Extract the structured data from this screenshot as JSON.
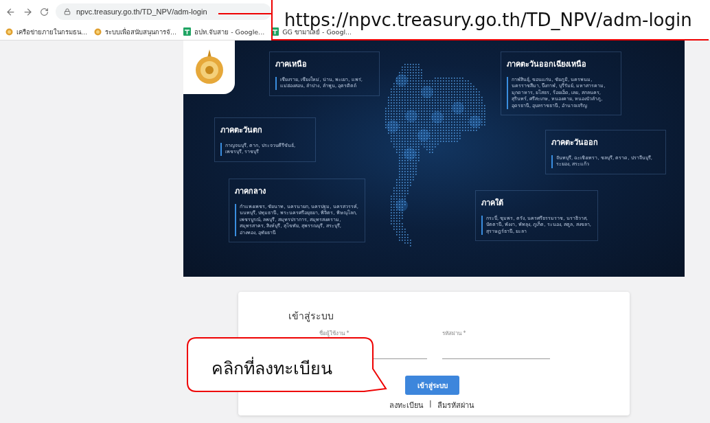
{
  "browser": {
    "url": "npvc.treasury.go.th/TD_NPV/adm-login",
    "bookmarks": [
      {
        "label": "เครือข่ายภายในกรมธน...",
        "kind": "emblem"
      },
      {
        "label": "ระบบเพื่อสนับสนุนการจั...",
        "kind": "emblem"
      },
      {
        "label": "อปท.จับสาย - Google...",
        "kind": "sheets"
      },
      {
        "label": "GG ขามาเลย์ - Googl...",
        "kind": "sheets"
      }
    ]
  },
  "banner": {
    "regions": [
      {
        "title": "ภาคเหนือ",
        "provinces": "เชียงราย, เชียงใหม่, น่าน, พะเยา, แพร่, แม่ฮ่องสอน, ลำปาง, ลำพูน, อุตรดิตถ์"
      },
      {
        "title": "ภาคตะวันตก",
        "provinces": "กาญจนบุรี, ตาก, ประจวบคีรีขันธ์, เพชรบุรี, ราชบุรี"
      },
      {
        "title": "ภาคกลาง",
        "provinces": "กำแพงเพชร, ชัยนาท, นครนายก, นครปฐม, นครสวรรค์, นนทบุรี, ปทุมธานี, พระนครศรีอยุธยา, พิจิตร, พิษณุโลก, เพชรบูรณ์, ลพบุรี, สมุทรปราการ, สมุทรสงคราม, สมุทรสาคร, สิงห์บุรี, สุโขทัย, สุพรรณบุรี, สระบุรี, อ่างทอง, อุทัยธานี"
      },
      {
        "title": "ภาคตะวันออกเฉียงเหนือ",
        "provinces": "กาฬสินธุ์, ขอนแก่น, ชัยภูมิ, นครพนม, นครราชสีมา, บึงกาฬ, บุรีรัมย์, มหาสารคาม, มุกดาหาร, ยโสธร, ร้อยเอ็ด, เลย, สกลนคร, สุรินทร์, ศรีสะเกษ, หนองคาย, หนองบัวลำภู, อุดรธานี, อุบลราชธานี, อำนาจเจริญ"
      },
      {
        "title": "ภาคตะวันออก",
        "provinces": "จันทบุรี, ฉะเชิงเทรา, ชลบุรี, ตราด, ปราจีนบุรี, ระยอง, สระแก้ว"
      },
      {
        "title": "ภาคใต้",
        "provinces": "กระบี่, ชุมพร, ตรัง, นครศรีธรรมราช, นราธิวาส, ปัตตานี, พังงา, พัทลุง, ภูเก็ต, ระนอง, สตูล, สงขลา, สุราษฎร์ธานี, ยะลา"
      }
    ]
  },
  "login": {
    "title": "เข้าสู่ระบบ",
    "fields": [
      {
        "label": "ชื่อผู้ใช้งาน *"
      },
      {
        "label": "รหัสผ่าน *"
      }
    ],
    "button": "เข้าสู่ระบบ",
    "links": [
      "ลงทะเบียน",
      "ลืมรหัสผ่าน"
    ],
    "separator": "|"
  },
  "annotations": [
    {
      "kind": "url-callout",
      "text": "https://npvc.treasury.go.th/TD_NPV/adm-login"
    },
    {
      "kind": "speech-bubble",
      "text": "คลิกที่ลงทะเบียน"
    }
  ]
}
